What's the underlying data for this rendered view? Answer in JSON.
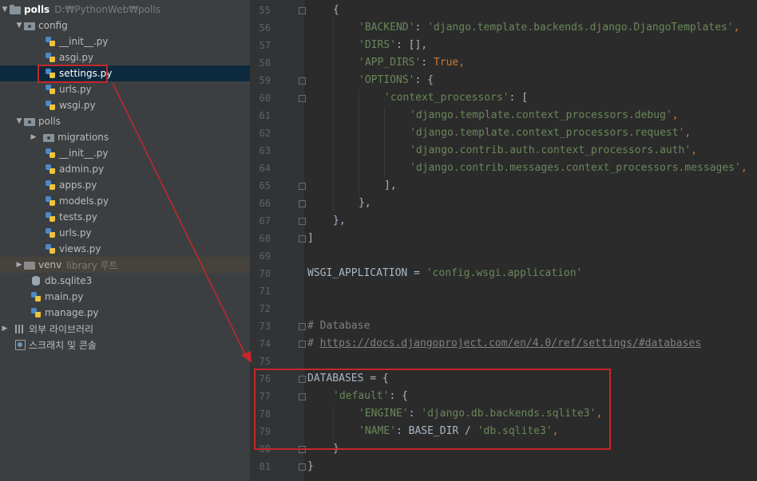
{
  "tree": {
    "root": {
      "name": "polls",
      "path": "D:₩PythonWeb₩polls"
    },
    "config": {
      "name": "config",
      "files": [
        "__init__.py",
        "asgi.py",
        "settings.py",
        "urls.py",
        "wsgi.py"
      ]
    },
    "polls": {
      "name": "polls",
      "migrations": "migrations",
      "files": [
        "__init__.py",
        "admin.py",
        "apps.py",
        "models.py",
        "tests.py",
        "urls.py",
        "views.py"
      ]
    },
    "venv": {
      "name": "venv",
      "hint": "library 루트"
    },
    "root_files": [
      "db.sqlite3",
      "main.py",
      "manage.py"
    ],
    "external_libraries": "외부 라이브러리",
    "scratches": "스크래치 및 콘솔"
  },
  "editor": {
    "line_numbers": [
      "55",
      "56",
      "57",
      "58",
      "59",
      "60",
      "61",
      "62",
      "63",
      "64",
      "65",
      "66",
      "67",
      "68",
      "69",
      "70",
      "71",
      "72",
      "73",
      "74",
      "75",
      "76",
      "77",
      "78",
      "79",
      "80",
      "81"
    ],
    "code": {
      "l55_brace": "{",
      "backend_key": "'BACKEND'",
      "backend_val": "'django.template.backends.django.DjangoTemplates'",
      "dirs_key": "'DIRS'",
      "dirs_val": ": [],",
      "app_dirs_key": "'APP_DIRS'",
      "app_dirs_val": "True",
      "options_key": "'OPTIONS'",
      "options_rest": ": {",
      "ctx_key": "'context_processors'",
      "ctx_rest": ": [",
      "ctx1": "'django.template.context_processors.debug'",
      "ctx2": "'django.template.context_processors.request'",
      "ctx3": "'django.contrib.auth.context_processors.auth'",
      "ctx4": "'django.contrib.messages.context_processors.messages'",
      "close_list": "],",
      "close_opts": "},",
      "close_tpl": "},",
      "close_templates": "]",
      "wsgi_name": "WSGI_APPLICATION = ",
      "wsgi_val": "'config.wsgi.application'",
      "comment_db": "# Database",
      "comment_hash": "# ",
      "comment_url": "https://docs.djangoproject.com/en/4.0/ref/settings/#databases",
      "databases": "DATABASES = {",
      "default_key": "'default'",
      "default_rest": ": {",
      "engine_key": "'ENGINE'",
      "engine_val": "'django.db.backends.sqlite3'",
      "name_key": "'NAME'",
      "name_mid": ": BASE_DIR / ",
      "name_val": "'db.sqlite3'",
      "close_default": "}",
      "close_databases": "}"
    }
  },
  "colors": {
    "string": "#6a8759",
    "keyword": "#cc7832",
    "comment": "#808080",
    "annotation_red": "#c4272a"
  }
}
